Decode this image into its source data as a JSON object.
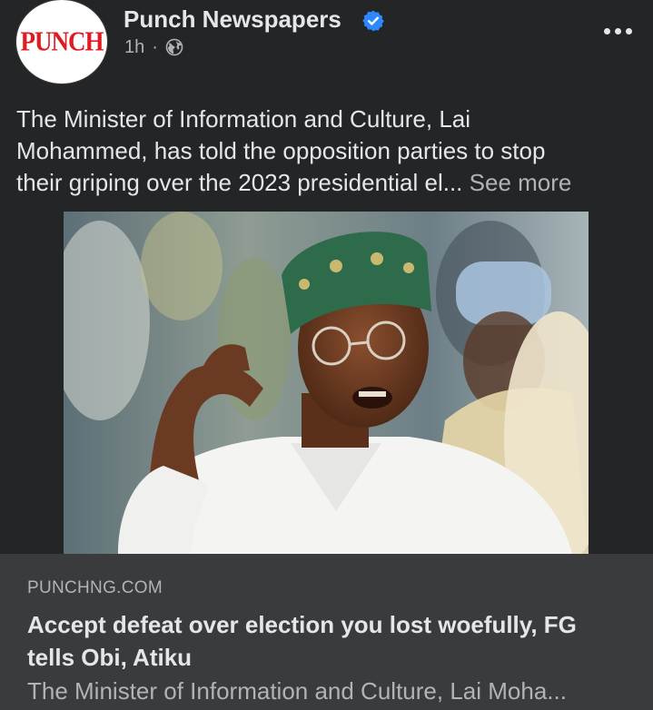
{
  "post": {
    "page_name": "Punch Newspapers",
    "logo_text": "PUNCH",
    "timestamp": "1h",
    "separator": "·",
    "audience_icon": "globe-icon",
    "verified_icon": "verified-badge-icon",
    "more_icon": "more-options-icon",
    "text_line_1": "The Minister of Information and Culture, Lai",
    "text_line_2": "Mohammed, has told the opposition parties to stop",
    "text_line_3": "their griping over the 2023 presidential el...",
    "see_more": "See more"
  },
  "link_preview": {
    "domain": "PUNCHNG.COM",
    "headline_line_1": "Accept defeat over election you lost woefully, FG",
    "headline_line_2": "tells Obi, Atiku",
    "description": "The Minister of Information and Culture, Lai Moha..."
  },
  "colors": {
    "background": "#242526",
    "card": "#3a3b3c",
    "primary_text": "#e4e6eb",
    "secondary_text": "#b0b3b8",
    "verified_blue": "#2d88ff",
    "logo_red": "#e01b22"
  }
}
